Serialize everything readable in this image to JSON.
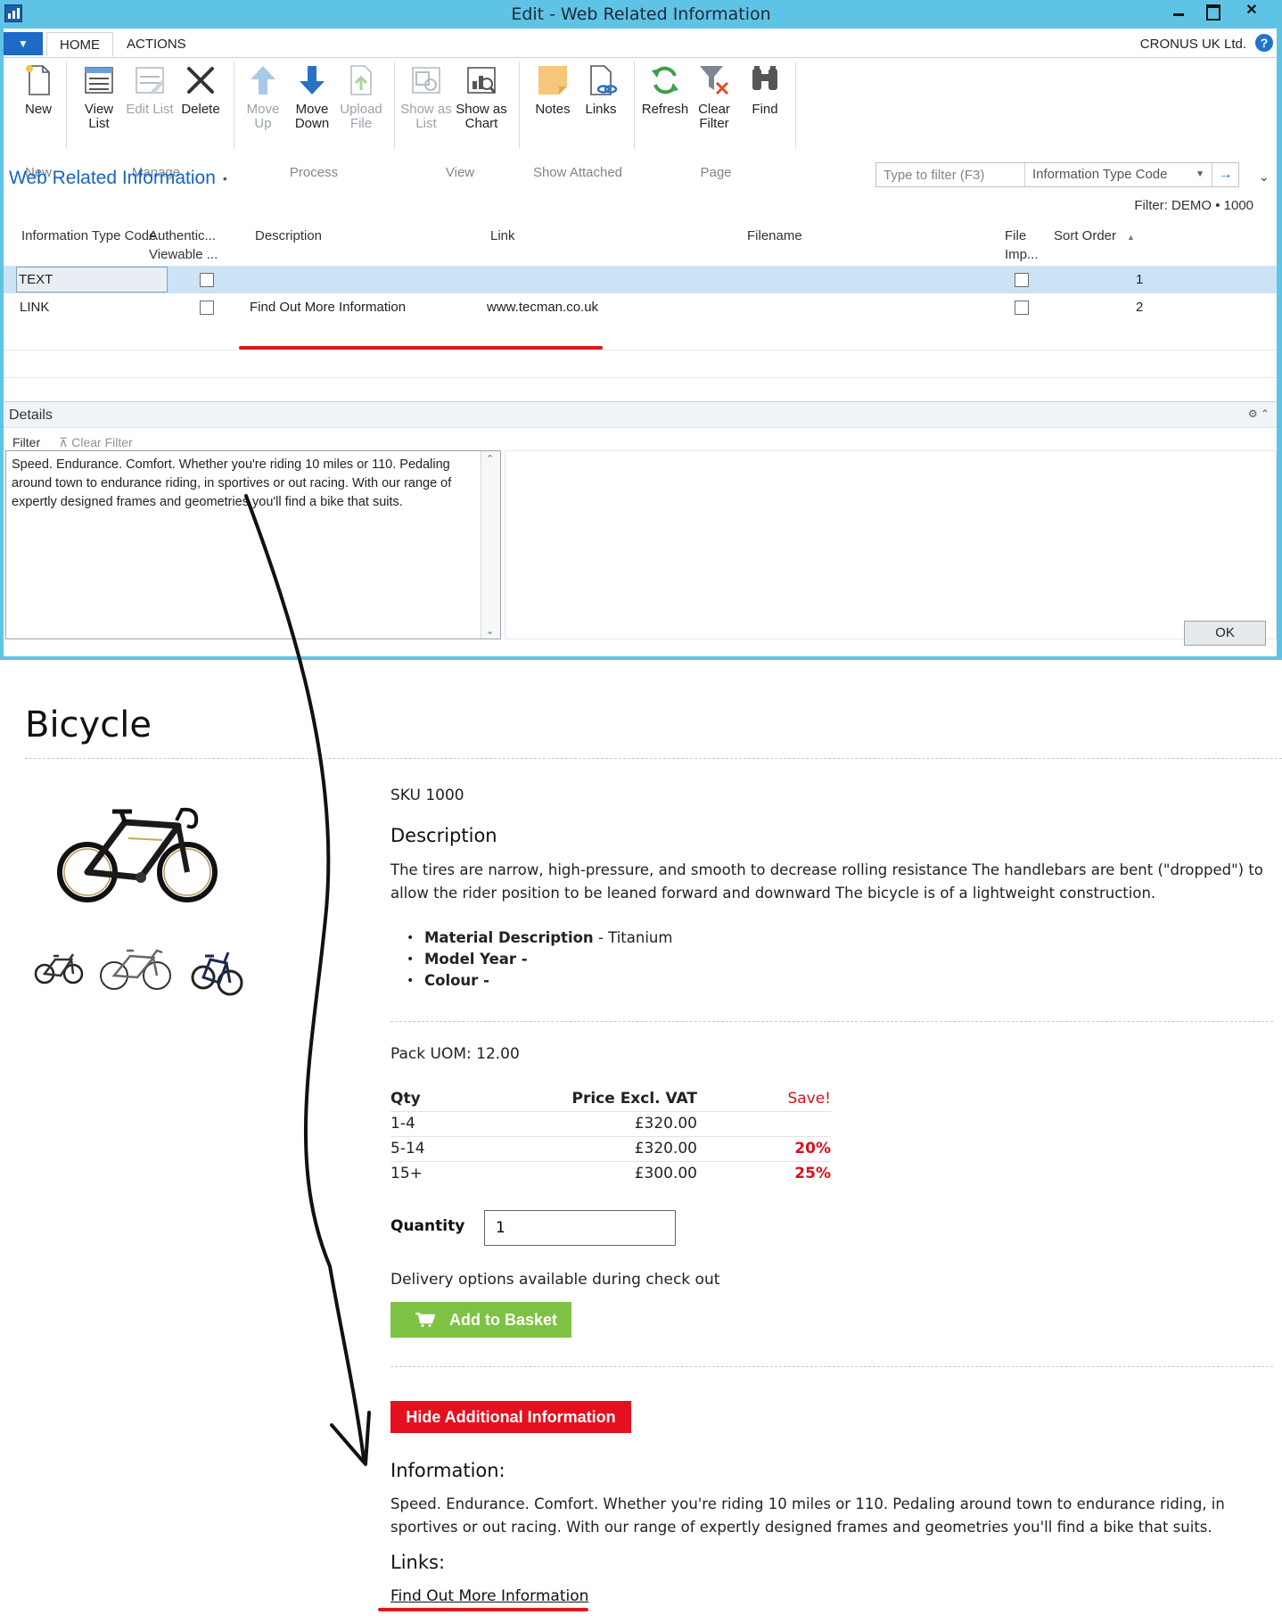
{
  "window": {
    "title": "Edit - Web Related Information",
    "close_glyph": "✕"
  },
  "tabs": {
    "home": "HOME",
    "actions": "ACTIONS"
  },
  "company": "CRONUS UK Ltd.",
  "help_glyph": "?",
  "ribbon": {
    "groups": {
      "new": "New",
      "manage": "Manage",
      "process": "Process",
      "view": "View",
      "show_attached": "Show Attached",
      "page": "Page"
    },
    "buttons": {
      "new": "New",
      "view_list": "View List",
      "edit_list": "Edit List",
      "delete": "Delete",
      "move_up": "Move Up",
      "move_down": "Move Down",
      "upload_file": "Upload File",
      "show_as_list": "Show as List",
      "show_as_chart": "Show as Chart",
      "notes": "Notes",
      "links": "Links",
      "refresh": "Refresh",
      "clear_filter": "Clear Filter",
      "find": "Find"
    },
    "icons": [
      "new-document-icon",
      "view-list-icon",
      "edit-list-icon",
      "delete-x-icon",
      "arrow-up-icon",
      "arrow-down-icon",
      "upload-file-icon",
      "show-as-list-icon",
      "show-as-chart-icon",
      "notes-icon",
      "links-icon",
      "refresh-icon",
      "clear-filter-icon",
      "binoculars-icon"
    ]
  },
  "list": {
    "title": "Web Related Information",
    "title_marker": "•",
    "filter_placeholder": "Type to filter (F3)",
    "filter_field": "Information Type Code",
    "filter_status": "Filter: DEMO • 1000",
    "columns": {
      "info_type_code": "Information Type Code",
      "authentic_viewable": "Authentic... Viewable ...",
      "description": "Description",
      "link": "Link",
      "filename": "Filename",
      "file_imp": "File Imp...",
      "sort_order": "Sort Order"
    },
    "rows": [
      {
        "code": "TEXT",
        "authentic_viewable": false,
        "description": "",
        "link": "",
        "filename": "",
        "file_imp": false,
        "sort_order": "1",
        "selected": true
      },
      {
        "code": "LINK",
        "authentic_viewable": false,
        "description": "Find Out More Information",
        "link": "www.tecman.co.uk",
        "filename": "",
        "file_imp": false,
        "sort_order": "2",
        "selected": false
      }
    ]
  },
  "details": {
    "title": "Details",
    "filter_label": "Filter",
    "clear_filter_label": "Clear Filter",
    "text": "Speed. Endurance. Comfort. Whether you're riding 10 miles or 110. Pedaling around town to endurance riding, in sportives or out racing. With our range of expertly designed frames and geometries you'll find a bike that suits."
  },
  "ok_label": "OK",
  "product": {
    "title": "Bicycle",
    "sku": "SKU 1000",
    "description_heading": "Description",
    "description": "The tires are narrow, high-pressure, and smooth to decrease rolling resistance The handlebars are bent (\"dropped\") to allow the rider position to be leaned forward and downward The bicycle is of a lightweight construction.",
    "attributes": [
      {
        "label": "Material Description",
        "value": "- Titanium"
      },
      {
        "label": "Model Year -",
        "value": ""
      },
      {
        "label": "Colour -",
        "value": ""
      }
    ],
    "pack_uom": "Pack UOM: 12.00",
    "price_table": {
      "headers": {
        "qty": "Qty",
        "price": "Price Excl. VAT",
        "save": "Save!"
      },
      "rows": [
        {
          "qty": "1-4",
          "price": "£320.00",
          "save": ""
        },
        {
          "qty": "5-14",
          "price": "£320.00",
          "save": "20%"
        },
        {
          "qty": "15+",
          "price": "£300.00",
          "save": "25%"
        }
      ]
    },
    "quantity_label": "Quantity",
    "quantity_value": "1",
    "delivery_text": "Delivery options available during check out",
    "add_to_basket": "Add to Basket",
    "hide_info_button": "Hide Additional Information",
    "information_heading": "Information:",
    "information_text": "Speed. Endurance. Comfort. Whether you're riding 10 miles or 110. Pedaling around town to endurance riding, in sportives or out racing. With our range of expertly designed frames and geometries you'll find a bike that suits.",
    "links_heading": "Links:",
    "link_text": "Find Out More Information"
  },
  "colors": {
    "window_frame": "#5fc3e6",
    "nav_blue": "#1565c0",
    "selected_row": "#cce3f5",
    "basket_green": "#7dc243",
    "hide_red": "#e4101f",
    "annotation_red": "#e0181b"
  }
}
